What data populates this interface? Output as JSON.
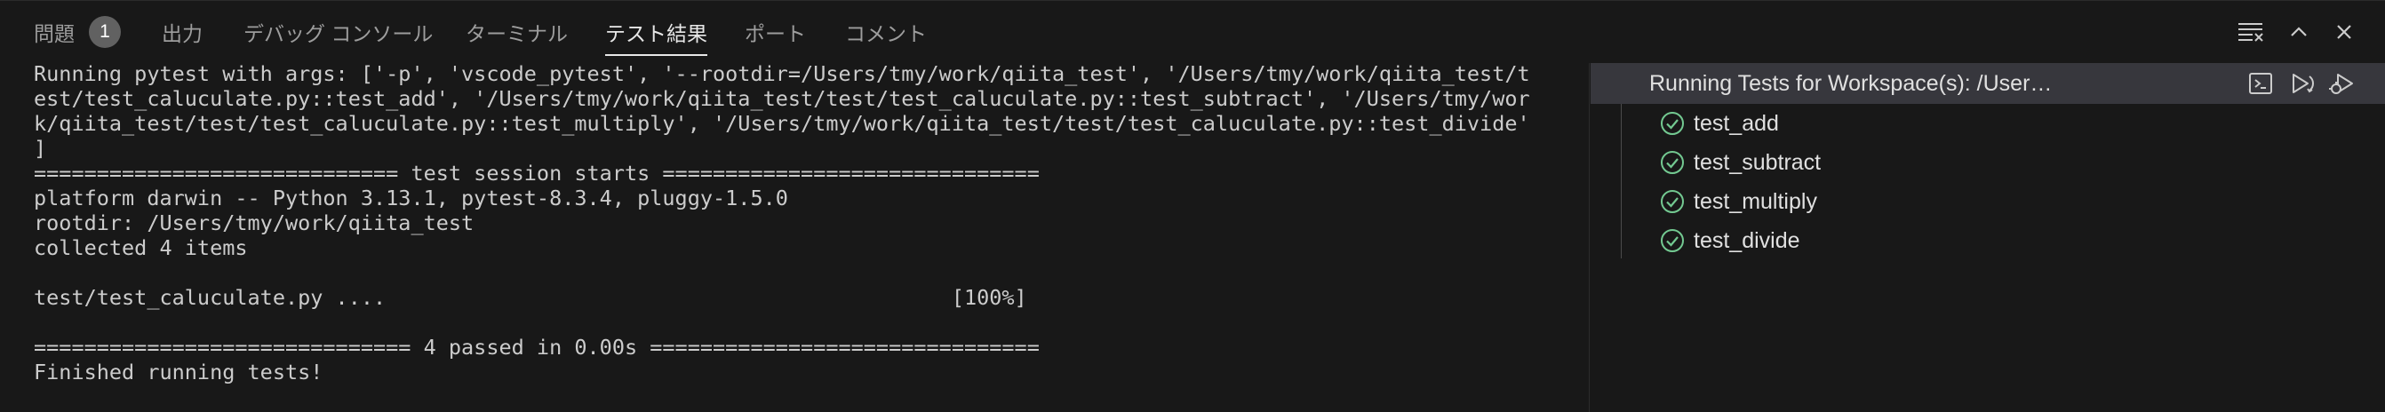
{
  "tabs": [
    {
      "label": "問題",
      "badge": "1"
    },
    {
      "label": "出力"
    },
    {
      "label": "デバッグ コンソール"
    },
    {
      "label": "ターミナル"
    },
    {
      "label": "テスト結果",
      "active": true
    },
    {
      "label": "ポート"
    },
    {
      "label": "コメント"
    }
  ],
  "toolbar_icons": [
    "clear-output-icon",
    "maximize-panel-icon",
    "close-panel-icon"
  ],
  "terminal_output": {
    "lines": [
      "Running pytest with args: ['-p', 'vscode_pytest', '--rootdir=/Users/tmy/work/qiita_test', '/Users/tmy/work/qiita_test/t",
      "est/test_caluculate.py::test_add', '/Users/tmy/work/qiita_test/test/test_caluculate.py::test_subtract', '/Users/tmy/wor",
      "k/qiita_test/test/test_caluculate.py::test_multiply', '/Users/tmy/work/qiita_test/test/test_caluculate.py::test_divide'",
      "]",
      "============================= test session starts ==============================",
      "platform darwin -- Python 3.13.1, pytest-8.3.4, pluggy-1.5.0",
      "rootdir: /Users/tmy/work/qiita_test",
      "collected 4 items",
      "",
      "test/test_caluculate.py ....                                             [100%]",
      "",
      "============================== 4 passed in 0.00s ===============================",
      "Finished running tests!"
    ]
  },
  "test_tree": {
    "header": "Running Tests for Workspace(s): /Users/tmy/work/qiita_test",
    "header_icons": [
      "open-terminal-icon",
      "run-tests-icon",
      "debug-tests-icon"
    ],
    "items": [
      {
        "label": "test_add",
        "status": "passed"
      },
      {
        "label": "test_subtract",
        "status": "passed"
      },
      {
        "label": "test_multiply",
        "status": "passed"
      },
      {
        "label": "test_divide",
        "status": "passed"
      }
    ]
  },
  "colors": {
    "background": "#181818",
    "header_highlight": "#37373d",
    "pass_green": "#73c991",
    "text": "#cccccc"
  }
}
